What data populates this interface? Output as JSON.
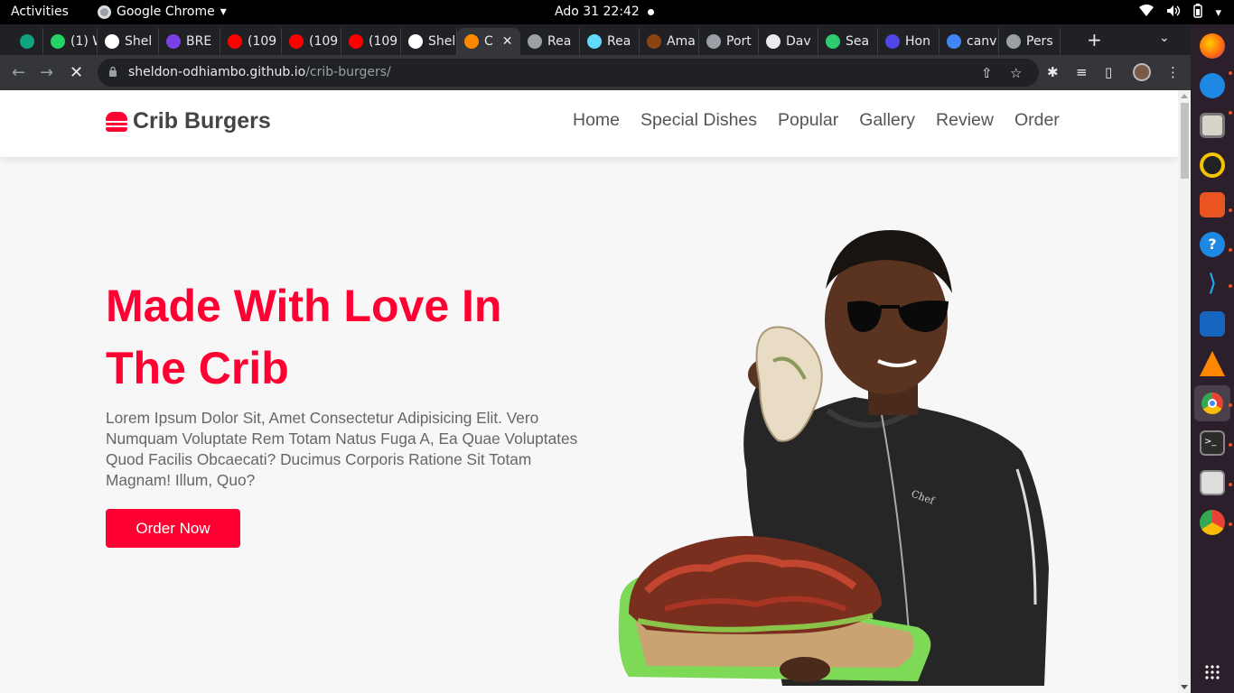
{
  "os_bar": {
    "activities": "Activities",
    "app_name": "Google Chrome",
    "clock": "Ado 31  22:42"
  },
  "browser": {
    "tabs": [
      {
        "label": "",
        "favicon_color": "#10a37f"
      },
      {
        "label": "(1) W",
        "favicon_color": "#25d366"
      },
      {
        "label": "Shel",
        "favicon_color": "#ffffff"
      },
      {
        "label": "BRE",
        "favicon_color": "#7b3fe4"
      },
      {
        "label": "(109",
        "favicon_color": "#ff0000"
      },
      {
        "label": "(109",
        "favicon_color": "#ff0000"
      },
      {
        "label": "(109",
        "favicon_color": "#ff0000"
      },
      {
        "label": "Shel",
        "favicon_color": "#ffffff"
      },
      {
        "label": "C",
        "favicon_color": "#ff8800",
        "active": true
      },
      {
        "label": "Rea",
        "favicon_color": "#9aa0a6"
      },
      {
        "label": "Rea",
        "favicon_color": "#61dafb"
      },
      {
        "label": "Ama",
        "favicon_color": "#8b4513"
      },
      {
        "label": "Port",
        "favicon_color": "#9aa0a6"
      },
      {
        "label": "Dav",
        "favicon_color": "#e8eaed"
      },
      {
        "label": "Sea",
        "favicon_color": "#2ecc71"
      },
      {
        "label": "Hon",
        "favicon_color": "#4f46e5"
      },
      {
        "label": "canv",
        "favicon_color": "#4285f4"
      },
      {
        "label": "Pers",
        "favicon_color": "#9aa0a6"
      }
    ],
    "url_host": "sheldon-odhiambo.github.io",
    "url_path": "/crib-burgers/"
  },
  "site": {
    "brand": "Crib Burgers",
    "brand_color": "#ff0033",
    "nav": [
      "Home",
      "Special Dishes",
      "Popular",
      "Gallery",
      "Review",
      "Order"
    ],
    "hero_title": "Made With Love In The Crib",
    "hero_text": "Lorem Ipsum Dolor Sit, Amet Consectetur Adipisicing Elit. Vero Numquam Voluptate Rem Totam Natus Fuga A, Ea Quae Voluptates Quod Facilis Obcaecati? Ducimus Corporis Ratione Sit Totam Magnam! Illum, Quo?",
    "cta": "Order Now"
  }
}
